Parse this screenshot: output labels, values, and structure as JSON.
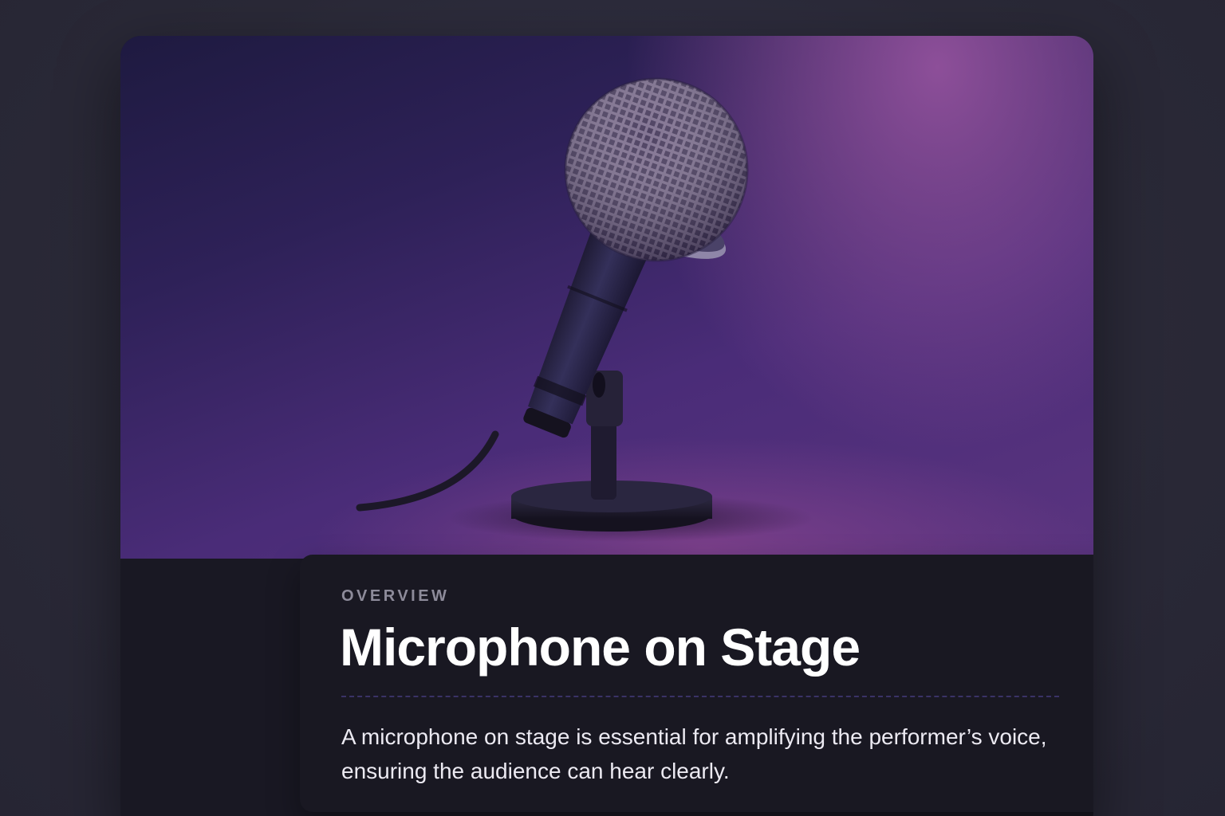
{
  "card": {
    "eyebrow": "OVERVIEW",
    "title": "Microphone on Stage",
    "description": "A microphone on stage is essential for amplifying the performer’s voice, ensuring the audience can hear clearly."
  },
  "hero": {
    "image": "microphone-on-stand-illustration"
  },
  "colors": {
    "background": "#2c2b3a",
    "card": "#191823",
    "accent_purple": "#8d4f99",
    "divider": "#3a3266",
    "eyebrow": "#8d8b9a",
    "title": "#ffffff"
  }
}
